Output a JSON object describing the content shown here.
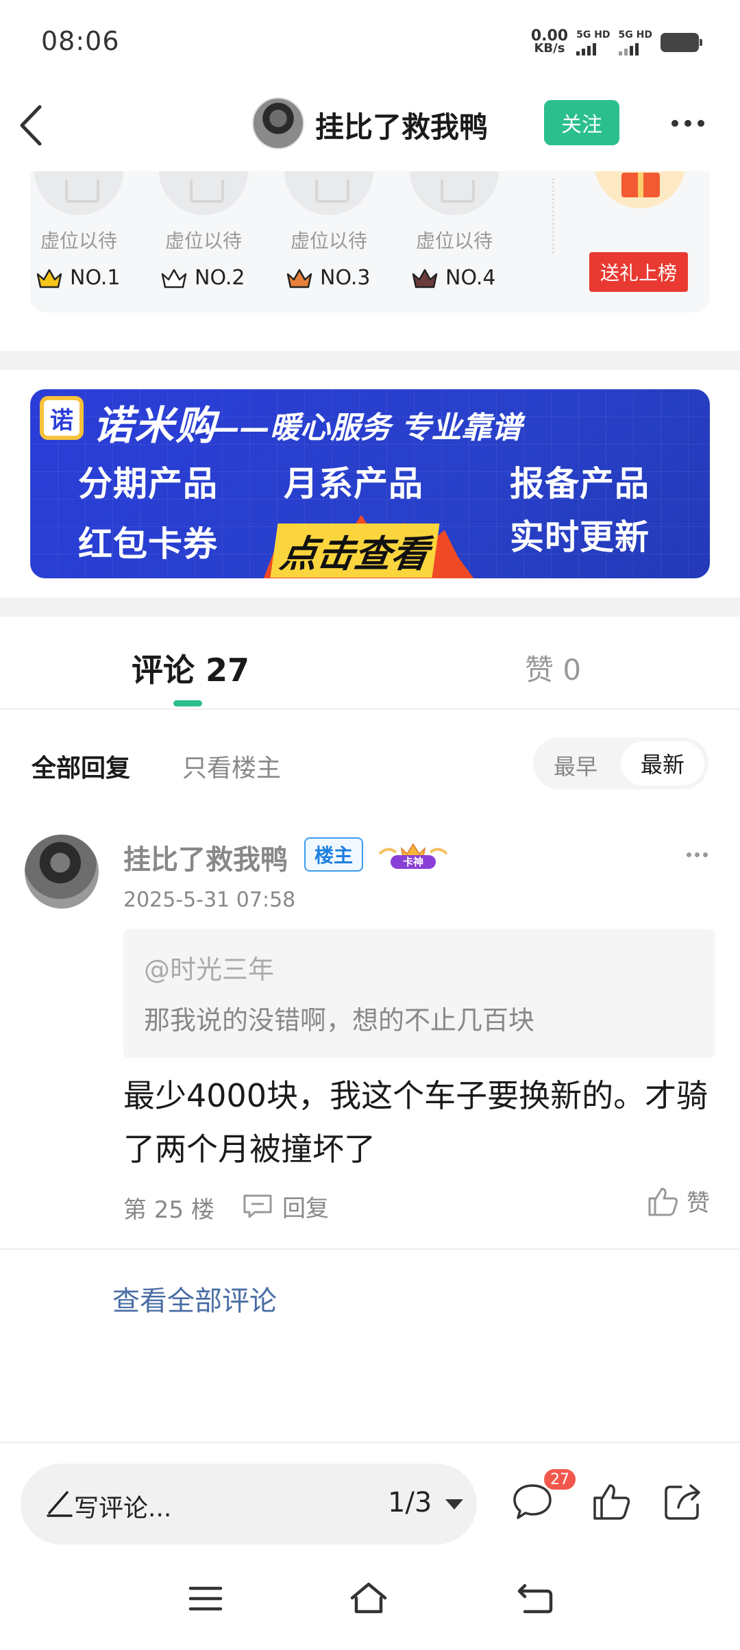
{
  "status_bar": {
    "time": "08:06",
    "net_speed_value": "0.00",
    "net_speed_unit": "KB/s",
    "sim1_label": "5G HD",
    "sim2_label": "5G HD"
  },
  "header": {
    "author_name": "挂比了救我鸭",
    "follow_label": "关注"
  },
  "rank": {
    "slots": [
      {
        "label": "虚位以待",
        "rank": "NO.1",
        "crown_color": "#f5c518"
      },
      {
        "label": "虚位以待",
        "rank": "NO.2",
        "crown_color": "#ffffff"
      },
      {
        "label": "虚位以待",
        "rank": "NO.3",
        "crown_color": "#e5813b"
      },
      {
        "label": "虚位以待",
        "rank": "NO.4",
        "crown_color": "#6b3a3a"
      }
    ],
    "send_gift_label": "送礼上榜"
  },
  "banner": {
    "logo_char": "诺",
    "brand": "诺米购",
    "slogan": "——暖心服务 专业靠谱",
    "items": [
      "分期产品",
      "月系产品",
      "报备产品",
      "红包卡券",
      "实时更新"
    ],
    "cta": "点击查看"
  },
  "tabs": {
    "comments_label": "评论 27",
    "likes_label": "赞 0"
  },
  "filter": {
    "all_label": "全部回复",
    "op_only_label": "只看楼主",
    "sort_early": "最早",
    "sort_new": "最新"
  },
  "comment": {
    "author": "挂比了救我鸭",
    "owner_badge": "楼主",
    "god_badge": "卡神",
    "time": "2025-5-31 07:58",
    "quote_user": "@时光三年",
    "quote_text": "那我说的没错啊，想的不止几百块",
    "body": "最少4000块，我这个车子要换新的。才骑了两个月被撞坏了",
    "floor": "第 25 楼",
    "reply_label": "回复",
    "like_label": "赞"
  },
  "view_all_label": "查看全部评论",
  "bottom_bar": {
    "placeholder": "写评论...",
    "page": "1/3",
    "comment_badge": "27"
  },
  "colors": {
    "accent": "#2bbf8e",
    "gift_red": "#e93a31",
    "link": "#4a6ea5"
  }
}
